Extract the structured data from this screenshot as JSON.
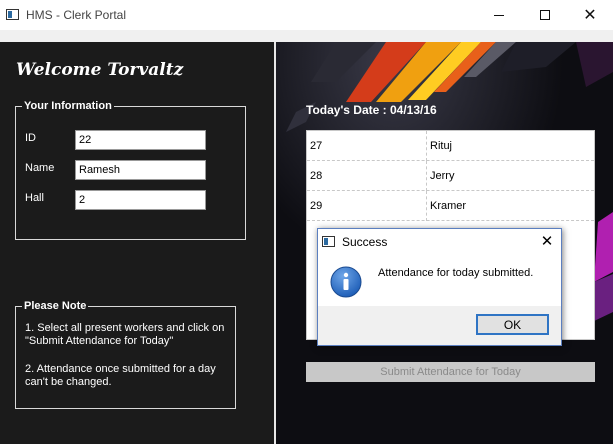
{
  "window": {
    "title": "HMS - Clerk Portal"
  },
  "welcome": "Welcome Torvaltz",
  "info": {
    "legend": "Your Information",
    "id_label": "ID",
    "id_value": "22",
    "name_label": "Name",
    "name_value": "Ramesh",
    "hall_label": "Hall",
    "hall_value": "2"
  },
  "note": {
    "legend": "Please Note",
    "line1": "1. Select all present workers and click on \"Submit Attendance for Today\"",
    "line2": "2. Attendance once submitted for a day can't be changed."
  },
  "date_label": "Today's Date : 04/13/16",
  "workers": [
    {
      "id": "27",
      "name": "Rituj"
    },
    {
      "id": "28",
      "name": "Jerry"
    },
    {
      "id": "29",
      "name": "Kramer"
    }
  ],
  "submit_label": "Submit Attendance for Today",
  "dialog": {
    "title": "Success",
    "message": "Attendance for today submitted.",
    "ok_label": "OK"
  },
  "colors": {
    "dialog_border": "#5b7fc0",
    "ok_focus": "#2f74c4",
    "info_icon": "#1f5fb8"
  }
}
